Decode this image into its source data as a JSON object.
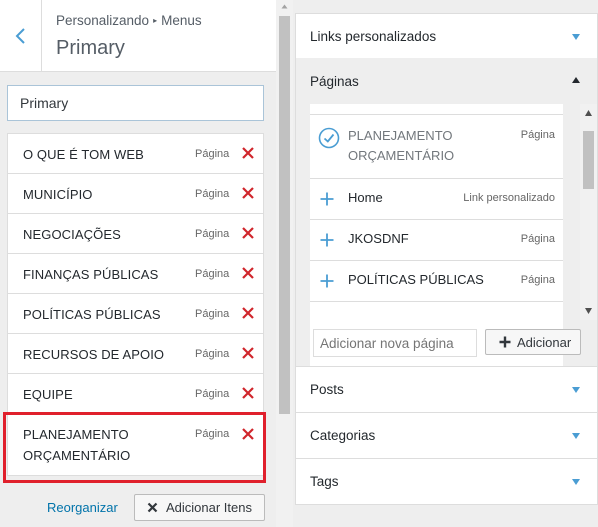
{
  "header": {
    "breadcrumb_part1": "Personalizando",
    "breadcrumb_sep": "▸",
    "breadcrumb_part2": "Menus",
    "title": "Primary"
  },
  "menu_name": {
    "value": "Primary"
  },
  "menu_items": [
    {
      "label": "O QUE É TOM WEB",
      "type": "Página"
    },
    {
      "label": "MUNICÍPIO",
      "type": "Página"
    },
    {
      "label": "NEGOCIAÇÕES",
      "type": "Página"
    },
    {
      "label": "FINANÇAS PÚBLICAS",
      "type": "Página"
    },
    {
      "label": "POLÍTICAS PÚBLICAS",
      "type": "Página"
    },
    {
      "label": "RECURSOS DE APOIO",
      "type": "Página"
    },
    {
      "label": "EQUIPE",
      "type": "Página"
    },
    {
      "label_line1": "PLANEJAMENTO",
      "label_line2": "ORÇAMENTÁRIO",
      "type": "Página"
    }
  ],
  "footer": {
    "reorder_label": "Reorganizar",
    "add_items_label": "Adicionar Itens"
  },
  "right_sections": {
    "custom_links": "Links personalizados",
    "pages": "Páginas",
    "posts": "Posts",
    "categories": "Categorias",
    "tags": "Tags"
  },
  "pages_list": [
    {
      "line1": "PLANEJAMENTO",
      "line2": "ORÇAMENTÁRIO",
      "type": "Página",
      "state": "added",
      "icon": "check-circle-icon"
    },
    {
      "line1": "Home",
      "type": "Link personalizado",
      "state": "available",
      "icon": "plus-icon"
    },
    {
      "line1": "JKOSDNF",
      "type": "Página",
      "state": "available",
      "icon": "plus-icon"
    },
    {
      "line1": "POLÍTICAS PÚBLICAS",
      "type": "Página",
      "state": "available",
      "icon": "plus-icon"
    }
  ],
  "new_page": {
    "placeholder": "Adicionar nova página",
    "add_label": "Adicionar"
  },
  "colors": {
    "accent": "#0073aa",
    "delete": "#d0252b",
    "highlight_box": "#e0202c",
    "caret": "#4a9dd3"
  }
}
